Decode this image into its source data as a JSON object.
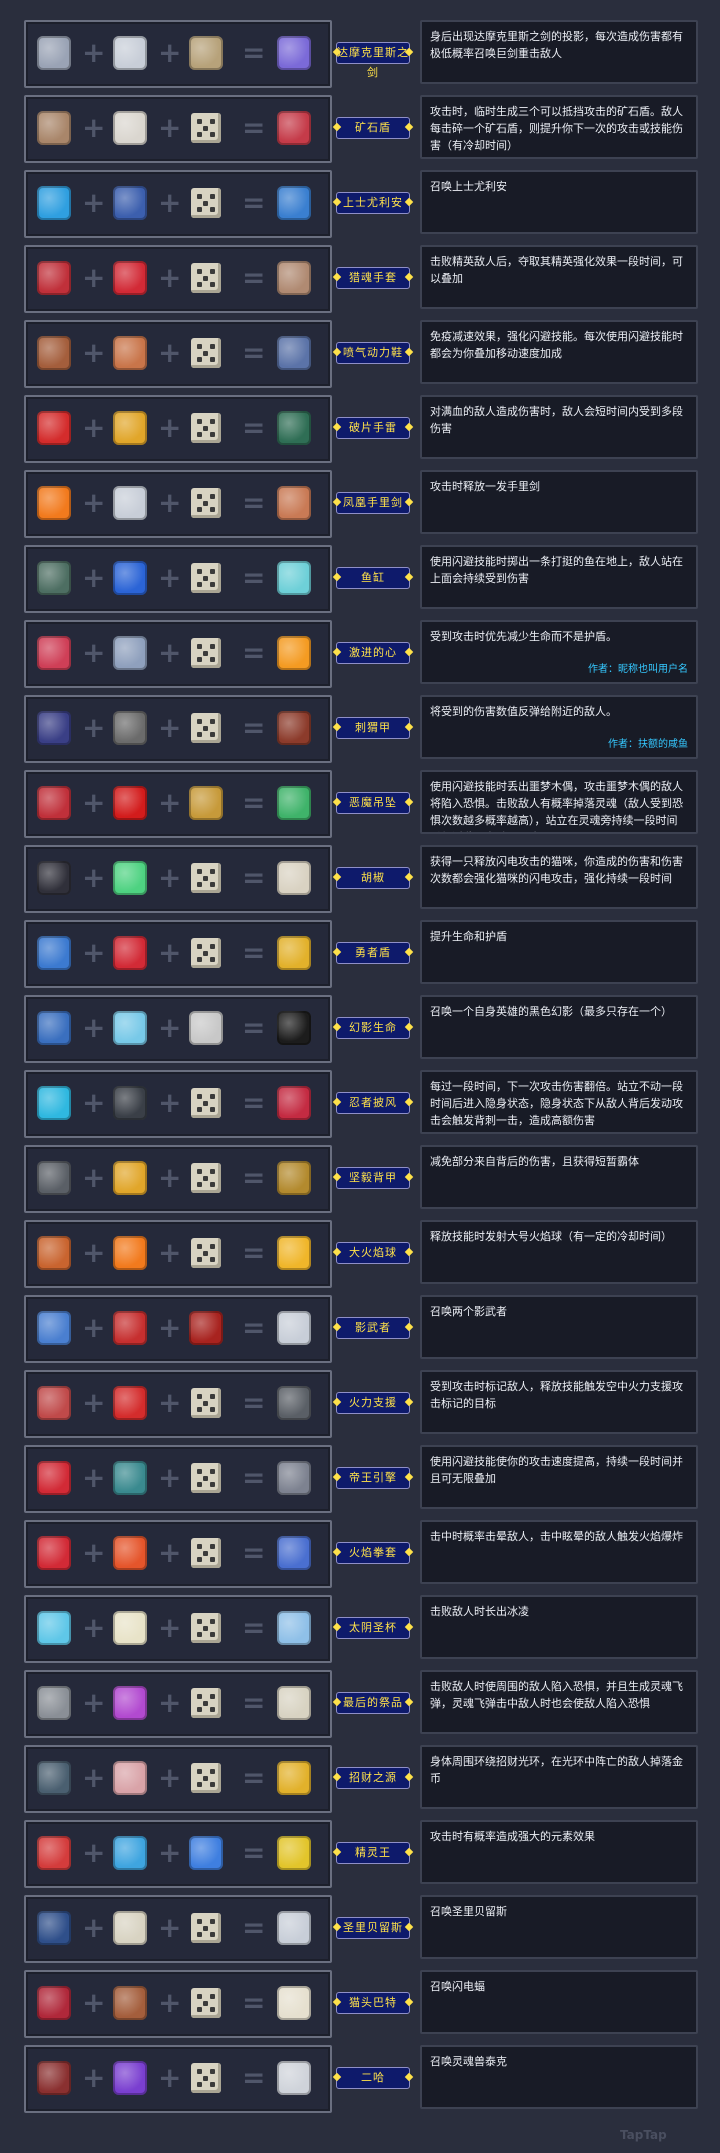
{
  "rows": [
    {
      "name": "达摩克里斯之剑",
      "desc": "身后出现达摩克里斯之剑的投影，每次造成伤害都有极低概率召唤巨剑重击敌人",
      "icons": [
        "sword-icon",
        "sword-icon",
        "sword-icon",
        "damocles-sword-icon"
      ],
      "colors": [
        "#9aa3b5",
        "#c8ced8",
        "#b7a27a",
        "#7b6ad8"
      ]
    },
    {
      "name": "矿石盾",
      "desc": "攻击时，临时生成三个可以抵挡攻击的矿石盾。敌人每击碎一个矿石盾，则提升你下一次的攻击或技能伤害（有冷却时间）",
      "icons": [
        "ore-icon",
        "stone-shard-icon",
        "dice-icon",
        "ore-shield-icon"
      ],
      "colors": [
        "#a9866a",
        "#dad6cf",
        "#d8d3c2",
        "#c53b49"
      ]
    },
    {
      "name": "上士尤利安",
      "desc": "召唤上士尤利安",
      "icons": [
        "recycle-book-icon",
        "soldier-helmet-icon",
        "dice-icon",
        "sergeant-icon"
      ],
      "colors": [
        "#2f9fe0",
        "#3c5fae",
        "#d8d3c2",
        "#3a7fd0"
      ]
    },
    {
      "name": "猎魂手套",
      "desc": "击败精英敌人后，夺取其精英强化效果一段时间，可以叠加",
      "icons": [
        "crossed-blades-icon",
        "heart-icon",
        "dice-icon",
        "gauntlet-icon"
      ],
      "colors": [
        "#c0303a",
        "#d22a36",
        "#d8d3c2",
        "#b08a72"
      ]
    },
    {
      "name": "喷气动力鞋",
      "desc": "免疫减速效果，强化闪避技能。每次使用闪避技能时都会为你叠加移动速度加成",
      "icons": [
        "boot-icon",
        "cloud-icon",
        "dice-icon",
        "jet-boot-icon"
      ],
      "colors": [
        "#a45e3c",
        "#c9754a",
        "#d8d3c2",
        "#5b73a8"
      ]
    },
    {
      "name": "破片手雷",
      "desc": "对满血的敌人造成伤害时，敌人会短时间内受到多段伤害",
      "icons": [
        "bomb-icon",
        "gold-ring-icon",
        "dice-icon",
        "grenade-icon"
      ],
      "colors": [
        "#d42c2c",
        "#e1a62a",
        "#d8d3c2",
        "#2f6e55"
      ]
    },
    {
      "name": "凤凰手里剑",
      "desc": "攻击时释放一发手里剑",
      "icons": [
        "fire-icon",
        "dagger-icon",
        "dice-icon",
        "shuriken-icon"
      ],
      "colors": [
        "#f27a1d",
        "#c8ced8",
        "#d8d3c2",
        "#c97a55"
      ]
    },
    {
      "name": "鱼缸",
      "desc": "使用闪避技能时掷出一条打挺的鱼在地上，敌人站在上面会持续受到伤害",
      "icons": [
        "crosshair-icon",
        "blue-flame-icon",
        "dice-icon",
        "fishbowl-icon"
      ],
      "colors": [
        "#4d6e62",
        "#2b64d6",
        "#d8d3c2",
        "#6ed0d8"
      ]
    },
    {
      "name": "激进的心",
      "desc": "受到攻击时优先减少生命而不是护盾。",
      "credit": "作者：昵称也叫用户名",
      "icons": [
        "heart-shield-icon",
        "shield-icon",
        "dice-icon",
        "fire-heart-icon"
      ],
      "colors": [
        "#cf3f57",
        "#8fa0bd",
        "#d8d3c2",
        "#f49b22"
      ]
    },
    {
      "name": "刺猬甲",
      "desc": "将受到的伤害数值反弹给附近的敌人。",
      "credit": "作者：扶额的咸鱼",
      "icons": [
        "hedgehog-icon",
        "vest-icon",
        "dice-icon",
        "spiked-armor-icon"
      ],
      "colors": [
        "#3a3f86",
        "#6b6b6b",
        "#d8d3c2",
        "#8c3b2b"
      ]
    },
    {
      "name": "恶魔吊坠",
      "desc": "使用闪避技能时丢出噩梦木偶，攻击噩梦木偶的敌人将陷入恐惧。击败敌人有概率掉落灵魂（敌人受到恐惧次数越多概率越高），站立在灵魂旁持续一段时间后复活敌人为随从跟班",
      "icons": [
        "skull-mask-icon",
        "red-ball-icon",
        "bell-icon",
        "demon-pendant-icon"
      ],
      "colors": [
        "#c0303a",
        "#d31c1c",
        "#c79a3a",
        "#3fb36a"
      ]
    },
    {
      "name": "胡椒",
      "desc": "获得一只释放闪电攻击的猫咪，你造成的伤害和伤害次数都会强化猫咪的闪电攻击，强化持续一段时间",
      "icons": [
        "black-cat-icon",
        "green-mushroom-icon",
        "dice-icon",
        "white-cat-icon"
      ],
      "colors": [
        "#30303a",
        "#4ed281",
        "#d8d3c2",
        "#d9d2c2"
      ]
    },
    {
      "name": "勇者盾",
      "desc": "提升生命和护盾",
      "icons": [
        "shield-icon",
        "heart-icon",
        "dice-icon",
        "hero-shield-icon"
      ],
      "colors": [
        "#3c7ad0",
        "#d22a36",
        "#d8d3c2",
        "#e2b12b"
      ]
    },
    {
      "name": "幻影生命",
      "desc": "召唤一个自身英雄的黑色幻影（最多只存在一个）",
      "icons": [
        "magnifier-icon",
        "crystal-icon",
        "headphones-icon",
        "shadow-icon"
      ],
      "colors": [
        "#3a6fbf",
        "#78c9e8",
        "#c8c8c8",
        "#1c1c1c"
      ]
    },
    {
      "name": "忍者披风",
      "desc": "每过一段时间，下一次攻击伤害翻倍。站立不动一段时间后进入隐身状态，隐身状态下从敌人背后发动攻击会触发背刺一击，造成高额伤害",
      "icons": [
        "blue-fire-icon",
        "hood-icon",
        "dice-icon",
        "ninja-cape-icon"
      ],
      "colors": [
        "#2fb8e0",
        "#3a3f47",
        "#d8d3c2",
        "#c42b42"
      ]
    },
    {
      "name": "坚毅背甲",
      "desc": "减免部分来自背后的伤害，且获得短暂霸体",
      "icons": [
        "backpack-icon",
        "gold-armor-icon",
        "dice-icon",
        "back-armor-icon"
      ],
      "colors": [
        "#5a5f66",
        "#e1a62a",
        "#d8d3c2",
        "#b38a2e"
      ]
    },
    {
      "name": "大火焰球",
      "desc": "释放技能时发射大号火焰球（有一定的冷却时间）",
      "icons": [
        "mushroom-icon",
        "fire-icon",
        "dice-icon",
        "fireball-icon"
      ],
      "colors": [
        "#c9642f",
        "#f27a1d",
        "#d8d3c2",
        "#f0b62a"
      ]
    },
    {
      "name": "影武者",
      "desc": "召唤两个影武者",
      "icons": [
        "crystal-ball-icon",
        "red-hair-icon",
        "samurai-mask-icon",
        "knight-helmet-icon"
      ],
      "colors": [
        "#4a7fd0",
        "#c62f2f",
        "#a8231f",
        "#c8ced8"
      ]
    },
    {
      "name": "火力支援",
      "desc": "受到攻击时标记敌人，释放技能触发空中火力支援攻击标记的目标",
      "icons": [
        "claw-glove-icon",
        "rocket-icon",
        "dice-icon",
        "fire-support-icon"
      ],
      "colors": [
        "#c04a4a",
        "#d42c2c",
        "#d8d3c2",
        "#5a5f66"
      ]
    },
    {
      "name": "帝王引擎",
      "desc": "使用闪避技能使你的攻击速度提高，持续一段时间并且可无限叠加",
      "icons": [
        "heart-icon",
        "potion-icon",
        "dice-icon",
        "engine-icon"
      ],
      "colors": [
        "#d22a36",
        "#3a8a8f",
        "#d8d3c2",
        "#7d8290"
      ]
    },
    {
      "name": "火焰拳套",
      "desc": "击中时概率击晕敌人，击中眩晕的敌人触发火焰爆炸",
      "icons": [
        "heart-icon",
        "spark-icon",
        "dice-icon",
        "flame-fist-icon"
      ],
      "colors": [
        "#d22a36",
        "#e5552b",
        "#d8d3c2",
        "#4a6fd0"
      ]
    },
    {
      "name": "太阴圣杯",
      "desc": "击败敌人时长出冰凌",
      "icons": [
        "ice-spark-icon",
        "chalice-icon",
        "dice-icon",
        "ice-chalice-icon"
      ],
      "colors": [
        "#5fc7e8",
        "#e8e3c8",
        "#d8d3c2",
        "#8fc0e8"
      ]
    },
    {
      "name": "最后的祭品",
      "desc": "击败敌人时使周围的敌人陷入恐惧，并且生成灵魂飞弹，灵魂飞弹击中敌人时也会使敌人陷入恐惧",
      "icons": [
        "demon-skull-icon",
        "purple-blade-icon",
        "dice-icon",
        "skull-helmet-icon"
      ],
      "colors": [
        "#8a8f96",
        "#b24ad0",
        "#d8d3c2",
        "#d8d3c2"
      ]
    },
    {
      "name": "招财之源",
      "desc": "身体周围环绕招财光环，在光环中阵亡的敌人掉落金币",
      "icons": [
        "gear-icon",
        "lucky-cat-icon",
        "dice-icon",
        "treasure-chest-icon"
      ],
      "colors": [
        "#4a5f70",
        "#d9a3a8",
        "#d8d3c2",
        "#e2b12b"
      ]
    },
    {
      "name": "精灵王",
      "desc": "攻击时有概率造成强大的元素效果",
      "icons": [
        "red-sprite-icon",
        "blue-sprite-icon",
        "blue-sprite-icon",
        "elf-king-icon"
      ],
      "colors": [
        "#d43c3c",
        "#3fa5e0",
        "#3f7fe0",
        "#e2c52b"
      ]
    },
    {
      "name": "圣里贝留斯",
      "desc": "召唤圣里贝留斯",
      "icons": [
        "horned-helmet-icon",
        "bone-cross-icon",
        "dice-icon",
        "paladin-icon"
      ],
      "colors": [
        "#2f4f8a",
        "#d8d3c2",
        "#d8d3c2",
        "#c8ced8"
      ]
    },
    {
      "name": "猫头巴特",
      "desc": "召唤闪电蝠",
      "icons": [
        "red-demon-icon",
        "boot-icon",
        "dice-icon",
        "owl-icon"
      ],
      "colors": [
        "#b0283a",
        "#a45e3c",
        "#d8d3c2",
        "#e6e0cf"
      ]
    },
    {
      "name": "二哈",
      "desc": "召唤灵魂兽泰克",
      "icons": [
        "werewolf-icon",
        "purple-cat-icon",
        "dice-icon",
        "husky-icon"
      ],
      "colors": [
        "#8a3030",
        "#7a3fd0",
        "#d8d3c2",
        "#cfd3da"
      ]
    }
  ],
  "watermark": "TapTap"
}
